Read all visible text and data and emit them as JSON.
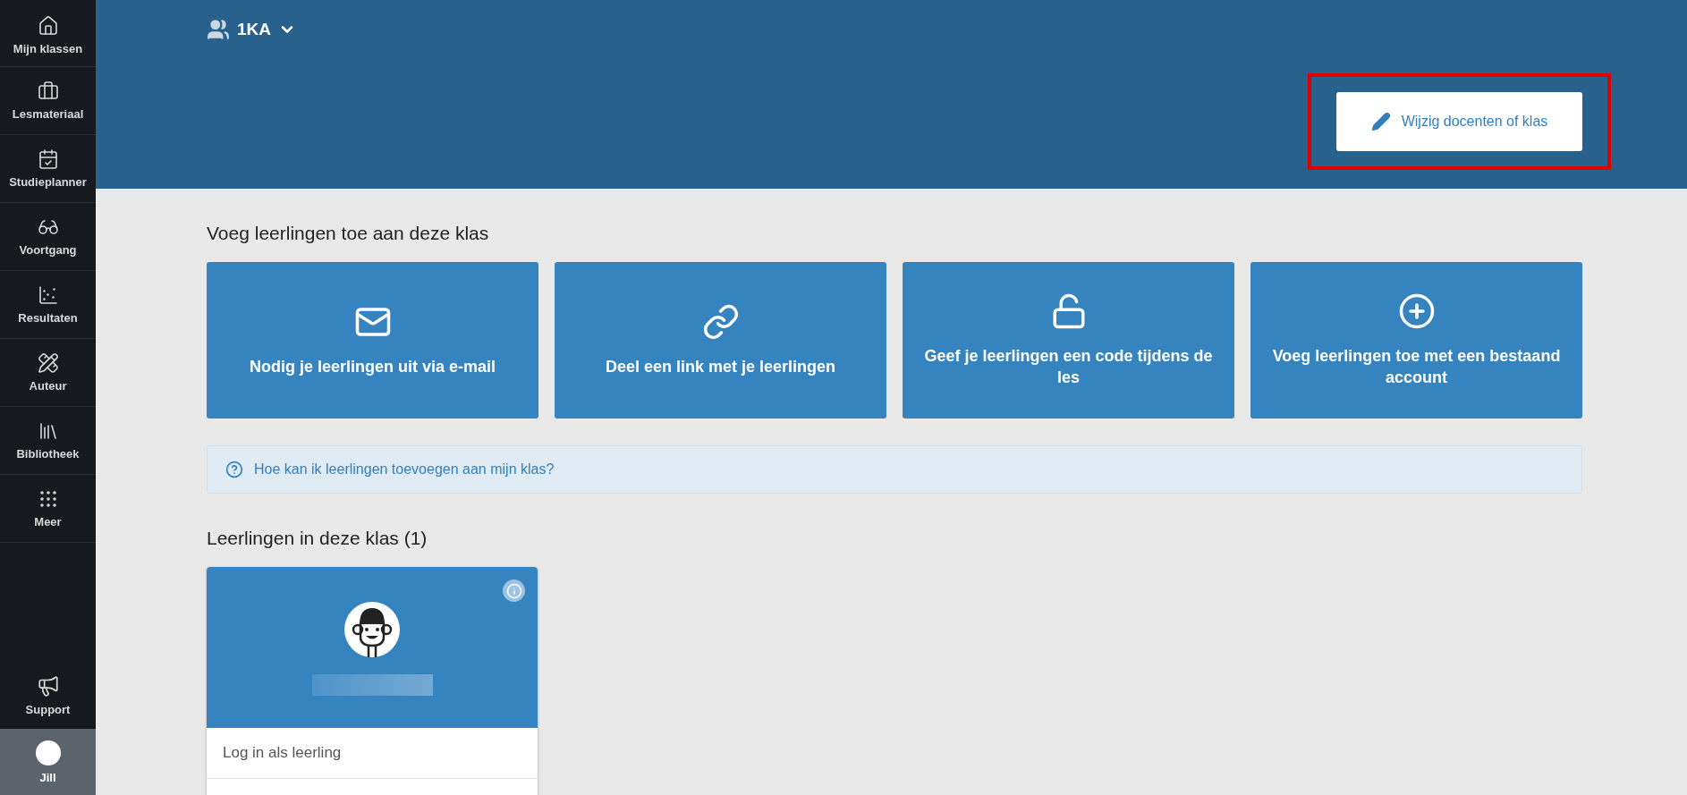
{
  "sidebar": {
    "items": [
      {
        "label": "Mijn klassen"
      },
      {
        "label": "Lesmateriaal"
      },
      {
        "label": "Studieplanner"
      },
      {
        "label": "Voortgang"
      },
      {
        "label": "Resultaten"
      },
      {
        "label": "Auteur"
      },
      {
        "label": "Bibliotheek"
      },
      {
        "label": "Meer"
      }
    ],
    "support": {
      "label": "Support"
    },
    "user": {
      "label": "Jill"
    }
  },
  "header": {
    "class_name": "1KA",
    "edit_button": "Wijzig docenten of klas",
    "highlighted": true
  },
  "add_section": {
    "title": "Voeg leerlingen toe aan deze klas",
    "options": [
      {
        "label": "Nodig je leerlingen uit via e-mail"
      },
      {
        "label": "Deel een link met je leerlingen"
      },
      {
        "label": "Geef je leerlingen een code tijdens de les"
      },
      {
        "label": "Voeg leerlingen toe met een bestaand account"
      }
    ],
    "help_link": "Hoe kan ik leerlingen toevoegen aan mijn klas?"
  },
  "students_section": {
    "title": "Leerlingen in deze klas (1)",
    "students": [
      {
        "action": "Log in als leerling"
      }
    ]
  }
}
